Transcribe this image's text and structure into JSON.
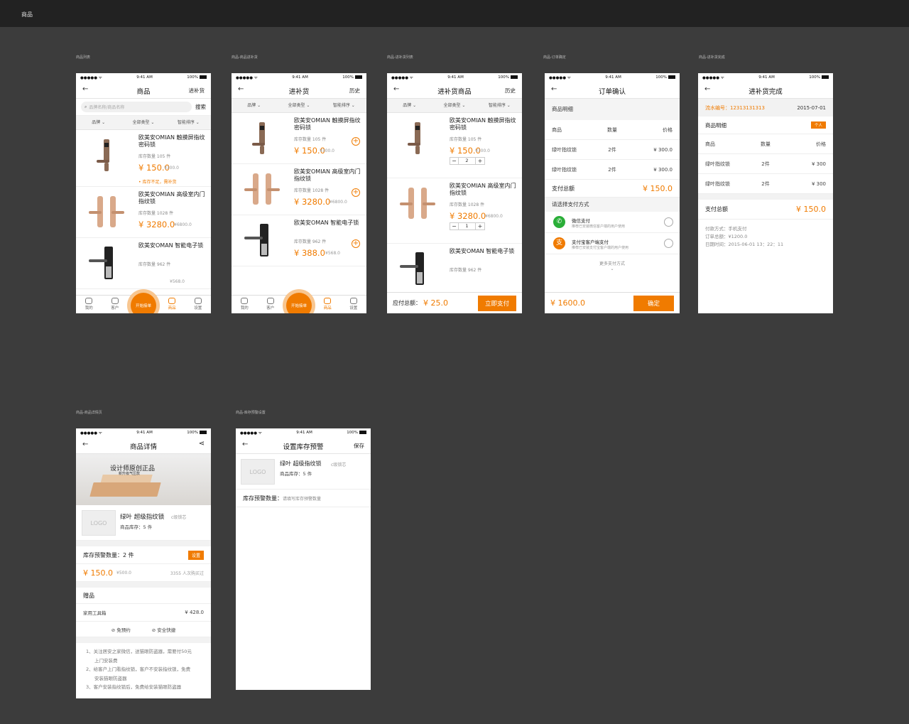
{
  "header": {
    "title": "商品"
  },
  "labels": {
    "p1": "商品列表",
    "p2": "商品-商品进补货",
    "p3": "商品-进补货列表",
    "p4": "商品-订单确定",
    "p5": "商品-进补货完成",
    "p6": "商品-商品详情页",
    "p7": "商品-库存预警设置"
  },
  "status": {
    "time": "9:41 AM",
    "battery": "100%"
  },
  "filters": [
    "品牌 ⌄",
    "全部类型 ⌄",
    "智能排序 ⌄"
  ],
  "products": [
    {
      "name": "欧美安OMIAN 触摸屏指纹密码锁",
      "stock": "库存数量 105 件",
      "price": "¥ 150.0",
      "orig": "¥300.0"
    },
    {
      "name": "欧美安OMIAN 高级室内门指纹锁",
      "stock": "库存数量 1028 件",
      "price": "¥ 3280.0",
      "orig": "¥6800.0"
    },
    {
      "name": "欧美安OMAN 智能电子锁",
      "stock": "库存数量 962 件",
      "price": "¥ 388.0",
      "orig": "¥568.0"
    }
  ],
  "screen1": {
    "title": "商品",
    "right": "进补货",
    "search_placeholder": "品牌名称/商品名称",
    "search_btn": "搜索",
    "warn": "• 库存不足，需补货",
    "p1_orig": "¥300.0",
    "p3_orig": "¥568.0",
    "tabs": [
      "我的",
      "客户",
      "商品",
      "设置"
    ],
    "fab": "开始接单"
  },
  "screen2": {
    "title": "进补货",
    "right": "历史",
    "tabs": [
      "我的",
      "客户",
      "商品",
      "设置"
    ],
    "fab": "开始接单"
  },
  "screen3": {
    "title": "进补货商品",
    "right": "历史",
    "qty1": "2",
    "qty2": "1",
    "pay_label": "应付总额：",
    "pay_value": "¥ 25.0",
    "pay_btn": "立即支付"
  },
  "screen4": {
    "title": "订单确认",
    "section": "商品明细",
    "head": [
      "商品",
      "数量",
      "价格"
    ],
    "rows": [
      [
        "绿叶指纹锁",
        "2件",
        "¥ 300.0"
      ],
      [
        "绿叶指纹锁",
        "2件",
        "¥ 300.0"
      ]
    ],
    "total_label": "支付总额",
    "total_value": "¥ 150.0",
    "pay_section": "请选择支付方式",
    "wechat_title": "微信支付",
    "wechat_desc": "推荐已安装微信客户端的用户使用",
    "alipay_title": "支付宝客户端支付",
    "alipay_desc": "推荐已安装支付宝客户端的用户使用",
    "more": "更多支付方式",
    "bottom_value": "¥ 1600.0",
    "confirm": "确定"
  },
  "screen5": {
    "title": "进补货完成",
    "order_no": "流水编号：12313131313",
    "date": "2015-07-01",
    "section": "商品明细",
    "tag": "个人",
    "head": [
      "商品",
      "数量",
      "价格"
    ],
    "rows": [
      [
        "绿叶指纹锁",
        "2件",
        "¥ 300"
      ],
      [
        "绿叶指纹锁",
        "2件",
        "¥ 300"
      ]
    ],
    "total_label": "支付总额",
    "total_value": "¥ 150.0",
    "info1": "付款方式：手机支付",
    "info2": "订单总额：¥1200.0",
    "info3": "日期时间：2015-06-01 13：22：11"
  },
  "screen6": {
    "title": "商品详情",
    "banner_title": "设计师原创正品",
    "banner_sub": "新升级气压款",
    "logo": "LOGO",
    "name": "绿叶 超级指纹锁",
    "grade": "c级锁芯",
    "stock": "商品库存：5 件",
    "warn_label": "库存预警数量：2 件",
    "warn_btn": "设置",
    "price": "¥ 150.0",
    "orig": "¥500.0",
    "bought": "3355 人次购买过",
    "gift_section": "赠品",
    "gift_name": "家用工具箱",
    "gift_price": "¥ 428.0",
    "svc1": "免预约",
    "svc2": "安全快捷",
    "notes": [
      "1、关注居安之家微信，送猫眼防盗器，需要付50元",
      "上门安装费",
      "2、给客户上门看指纹锁，客户不安装指纹锁，免费",
      "安装猫眼防盗器",
      "3、客户安装指纹锁后，免费给安装猫眼防盗器"
    ]
  },
  "screen7": {
    "title": "设置库存预警",
    "right": "保存",
    "logo": "LOGO",
    "name": "绿叶 超级指纹锁",
    "grade": "c级锁芯",
    "stock": "商品库存：5 件",
    "warn_label": "库存预警数量：",
    "warn_placeholder": "请填写库存预警数量"
  },
  "colors": {
    "accent": "#f07b00",
    "background": "#3c3c3c",
    "header": "#222222"
  }
}
